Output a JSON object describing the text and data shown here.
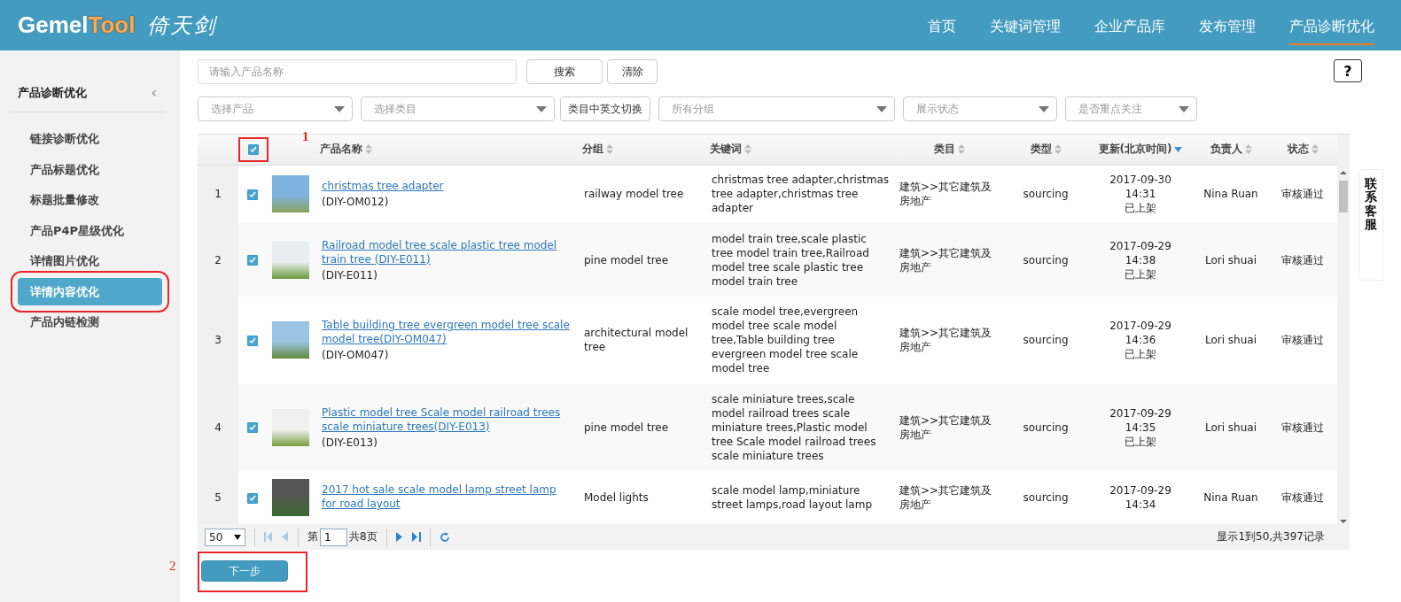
{
  "logo": {
    "brand_a": "Gemel",
    "brand_b": "Tool",
    "tagline": "倚天剑"
  },
  "nav": [
    {
      "label": "首页",
      "selected": false
    },
    {
      "label": "关键词管理",
      "selected": false
    },
    {
      "label": "企业产品库",
      "selected": false
    },
    {
      "label": "发布管理",
      "selected": false
    },
    {
      "label": "产品诊断优化",
      "selected": true
    }
  ],
  "sidebar": {
    "title": "产品诊断优化",
    "collapse_icon": "‹",
    "items": [
      {
        "label": "链接诊断优化",
        "selected": false,
        "highlighted": false
      },
      {
        "label": "产品标题优化",
        "selected": false,
        "highlighted": false
      },
      {
        "label": "标题批量修改",
        "selected": false,
        "highlighted": false
      },
      {
        "label": "产品P4P星级优化",
        "selected": false,
        "highlighted": false
      },
      {
        "label": "详情图片优化",
        "selected": false,
        "highlighted": false
      },
      {
        "label": "详情内容优化",
        "selected": true,
        "highlighted": true
      },
      {
        "label": "产品内链检测",
        "selected": false,
        "highlighted": false
      }
    ]
  },
  "search": {
    "placeholder": "请输入产品名称",
    "buttons": [
      "搜索",
      "清除"
    ]
  },
  "filters": [
    {
      "kind": "select",
      "placeholder": "选择产品"
    },
    {
      "kind": "select",
      "placeholder": "选择类目"
    },
    {
      "kind": "button",
      "label": "类目中英文切换"
    },
    {
      "kind": "select",
      "placeholder": "所有分组"
    },
    {
      "kind": "select",
      "placeholder": "展示状态"
    },
    {
      "kind": "select",
      "placeholder": "是否重点关注"
    }
  ],
  "help": {
    "label": "?"
  },
  "side_tab": {
    "label": "联系客服"
  },
  "table": {
    "select_all": {
      "checked": true,
      "highlighted": true,
      "annotation": "1"
    },
    "columns": [
      {
        "label": "产品名称",
        "sorted": false
      },
      {
        "label": "分组",
        "sorted": false
      },
      {
        "label": "关键词",
        "sorted": false
      },
      {
        "label": "类目",
        "sorted": false
      },
      {
        "label": "类型",
        "sorted": false
      },
      {
        "label": "更新(北京时间)",
        "sorted": true
      },
      {
        "label": "负责人",
        "sorted": false
      },
      {
        "label": "状态",
        "sorted": false
      }
    ],
    "rows": [
      {
        "index": "1",
        "checked": true,
        "name": "christmas tree adapter",
        "code": "(DIY-OM012)",
        "group": "railway model tree",
        "keywords": "christmas tree adapter,christmas tree adapter,christmas tree adapter",
        "category": "建筑>>其它建筑及房地产",
        "type": "sourcing",
        "date": "2017-09-30",
        "time": "14:31",
        "shelf": "已上架",
        "owner": "Nina Ruan",
        "status": "审核通过"
      },
      {
        "index": "2",
        "checked": true,
        "name": "Railroad model tree scale plastic tree model train tree (DIY-E011)",
        "code": "(DIY-E011)",
        "group": "pine model tree",
        "keywords": "model train tree,scale plastic tree model train tree,Railroad model tree scale plastic tree model train tree",
        "category": "建筑>>其它建筑及房地产",
        "type": "sourcing",
        "date": "2017-09-29",
        "time": "14:38",
        "shelf": "已上架",
        "owner": "Lori shuai",
        "status": "审核通过"
      },
      {
        "index": "3",
        "checked": true,
        "name": "Table building tree evergreen model tree scale model tree(DIY-OM047)",
        "code": "(DIY-OM047)",
        "group": "architectural model tree",
        "keywords": "scale model tree,evergreen model tree scale model tree,Table building tree evergreen model tree scale model tree",
        "category": "建筑>>其它建筑及房地产",
        "type": "sourcing",
        "date": "2017-09-29",
        "time": "14:36",
        "shelf": "已上架",
        "owner": "Lori shuai",
        "status": "审核通过"
      },
      {
        "index": "4",
        "checked": true,
        "name": "Plastic model tree Scale model railroad trees scale miniature trees(DIY-E013)",
        "code": "(DIY-E013)",
        "group": "pine model tree",
        "keywords": "scale miniature trees,scale model railroad trees scale miniature trees,Plastic model tree Scale model railroad trees scale miniature trees",
        "category": "建筑>>其它建筑及房地产",
        "type": "sourcing",
        "date": "2017-09-29",
        "time": "14:35",
        "shelf": "已上架",
        "owner": "Lori shuai",
        "status": "审核通过"
      },
      {
        "index": "5",
        "checked": true,
        "name": "2017 hot sale scale model lamp street lamp for road layout",
        "group": "Model lights",
        "keywords": "scale model lamp,miniature street lamps,road layout lamp",
        "category": "建筑>>其它建筑及房地产",
        "type": "sourcing",
        "date": "2017-09-29",
        "time": "14:34",
        "owner": "Nina Ruan",
        "status": "审核通过"
      }
    ]
  },
  "pager": {
    "page_size": "50",
    "page_prefix": "第",
    "page": "1",
    "page_total": "共8页",
    "summary": "显示1到50,共397记录"
  },
  "next_button": {
    "label": "下一步",
    "highlighted": true,
    "annotation": "2"
  }
}
